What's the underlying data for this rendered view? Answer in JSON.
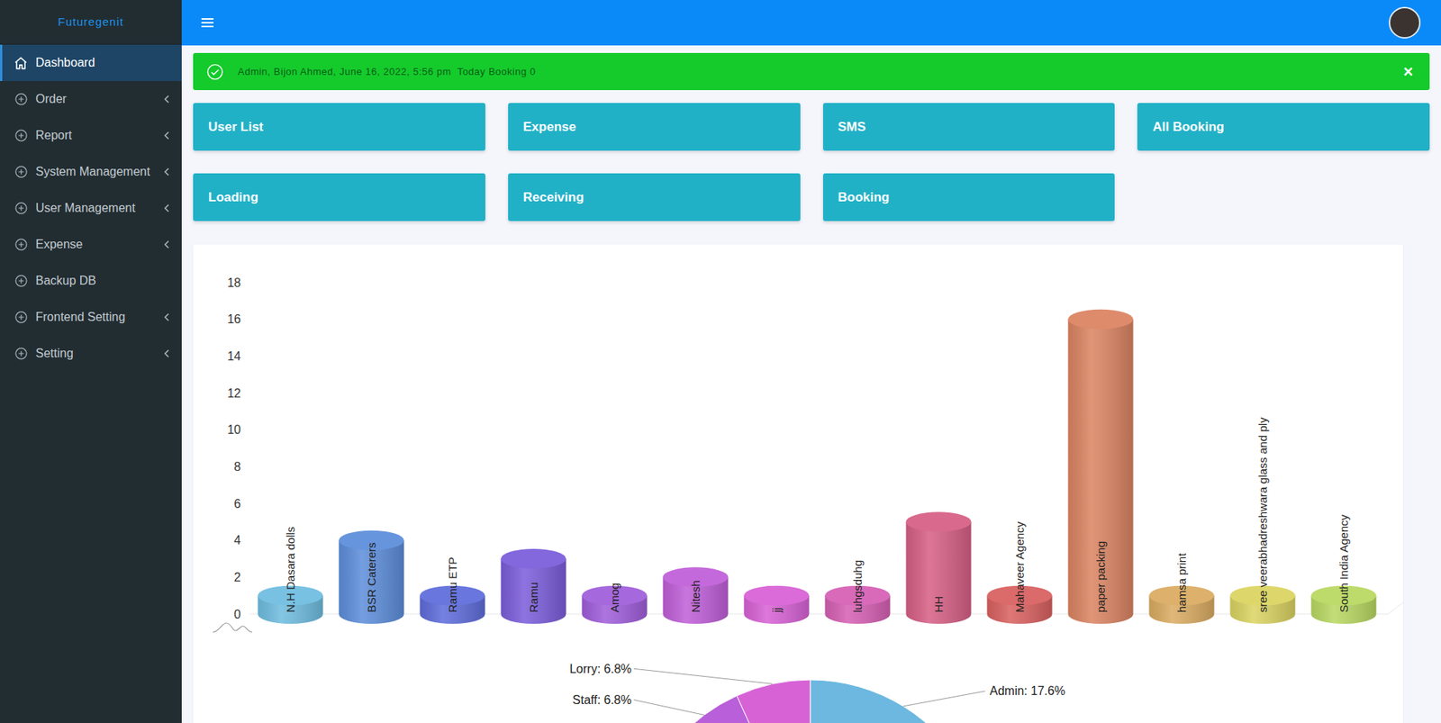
{
  "sidebar": {
    "brand": "Futuregenit",
    "items": [
      {
        "label": "Dashboard",
        "selected": true,
        "submenu": false
      },
      {
        "label": "Order",
        "selected": false,
        "submenu": true
      },
      {
        "label": "Report",
        "selected": false,
        "submenu": true
      },
      {
        "label": "System Management",
        "selected": false,
        "submenu": true
      },
      {
        "label": "User Management",
        "selected": false,
        "submenu": true
      },
      {
        "label": "Expense",
        "selected": false,
        "submenu": true
      },
      {
        "label": "Backup DB",
        "selected": false,
        "submenu": false
      },
      {
        "label": "Frontend Setting",
        "selected": false,
        "submenu": true
      },
      {
        "label": "Setting",
        "selected": false,
        "submenu": true
      }
    ]
  },
  "alert": {
    "message": "Admin, Bijon Ahmed, June 16, 2022, 5:56 pm",
    "booking": "Today Booking 0",
    "close": "×"
  },
  "cards": [
    "User List",
    "Expense",
    "SMS",
    "All Booking",
    "Loading",
    "Receiving",
    "Booking"
  ],
  "bar_chart": {
    "y_axis": {
      "min": 0,
      "max": 18,
      "ticks": [
        "0",
        "2",
        "4",
        "6",
        "8",
        "10",
        "12",
        "14",
        "16",
        "18"
      ]
    },
    "bars": [
      {
        "label": "N.H Dasara dolls",
        "value": 1,
        "color": "#6fbde0"
      },
      {
        "label": "BSR Caterers",
        "value": 4,
        "color": "#5d8edb"
      },
      {
        "label": "Ramu ETP",
        "value": 1,
        "color": "#5f6ddb"
      },
      {
        "label": "Ramu",
        "value": 3,
        "color": "#7b5ddb"
      },
      {
        "label": "Amog",
        "value": 1,
        "color": "#a05edb"
      },
      {
        "label": "Nitesh",
        "value": 2,
        "color": "#c05fd9"
      },
      {
        "label": "jj",
        "value": 1,
        "color": "#d862d6"
      },
      {
        "label": "luhgsduhg",
        "value": 1,
        "color": "#d660b4"
      },
      {
        "label": "HH",
        "value": 5,
        "color": "#d75f86"
      },
      {
        "label": "Mahaveer Agency",
        "value": 1,
        "color": "#d96160"
      },
      {
        "label": "paper packing",
        "value": 16,
        "color": "#db8462"
      },
      {
        "label": "hamsa print",
        "value": 1,
        "color": "#dbac62"
      },
      {
        "label": "sree veerabhadreshwara glass and ply",
        "value": 1,
        "color": "#dbd462"
      },
      {
        "label": "South India Agency",
        "value": 1,
        "color": "#b9d962"
      }
    ]
  },
  "pie_chart": {
    "slices": [
      {
        "label": "Admin: 17.6%",
        "value": 17.6,
        "color": "#6cb8e0"
      },
      {
        "label": "Staff: 6.8%",
        "value": 6.8,
        "color": "#b85fd9"
      },
      {
        "label": "Lorry: 6.8%",
        "value": 6.8,
        "color": "#d762d6"
      }
    ]
  }
}
